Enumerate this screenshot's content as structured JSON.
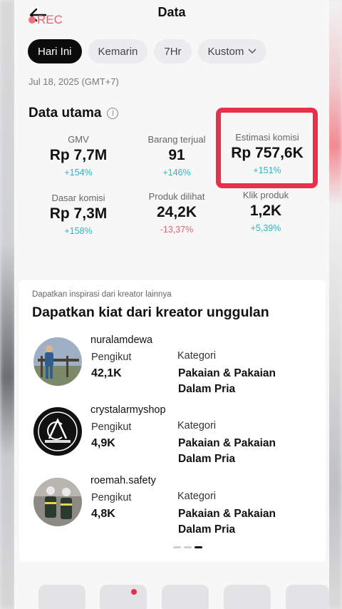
{
  "header": {
    "title": "Data",
    "rec_label": "REC"
  },
  "tabs": [
    {
      "label": "Hari Ini",
      "active": true
    },
    {
      "label": "Kemarin",
      "active": false
    },
    {
      "label": "7Hr",
      "active": false
    },
    {
      "label": "Kustom",
      "active": false
    }
  ],
  "date": "Jul 18, 2025 (GMT+7)",
  "main": {
    "title": "Data utama",
    "metrics": [
      {
        "label": "GMV",
        "value": "Rp 7,7M",
        "change": "+154%"
      },
      {
        "label": "Barang terjual",
        "value": "91",
        "change": "+146%"
      },
      {
        "label": "Estimasi komisi",
        "value": "Rp 757,6K",
        "change": "+151%"
      },
      {
        "label": "Dasar komisi",
        "value": "Rp 7,3M",
        "change": "+158%"
      },
      {
        "label": "Produk dilihat",
        "value": "24,2K",
        "change": "-13,37%"
      },
      {
        "label": "Klik produk",
        "value": "1,2K",
        "change": "+5,39%"
      }
    ]
  },
  "creators": {
    "subtitle": "Dapatkan inspirasi dari kreator lainnya",
    "title": "Dapatkan kiat dari kreator unggulan",
    "items": [
      {
        "name": "nuralamdewa",
        "followers_label": "Pengikut",
        "followers": "42,1K",
        "category_label": "Kategori",
        "category": "Pakaian & Pakaian Dalam Pria"
      },
      {
        "name": "crystalarmyshop",
        "followers_label": "Pengikut",
        "followers": "4,9K",
        "category_label": "Kategori",
        "category": "Pakaian & Pakaian Dalam Pria"
      },
      {
        "name": "roemah.safety",
        "followers_label": "Pengikut",
        "followers": "4,8K",
        "category_label": "Kategori",
        "category": "Pakaian & Pakaian Dalam Pria"
      }
    ],
    "pager_active_index": 2
  },
  "colors": {
    "accent_red": "#e8304a",
    "positive": "#28b8c2",
    "negative": "#e0646d"
  }
}
